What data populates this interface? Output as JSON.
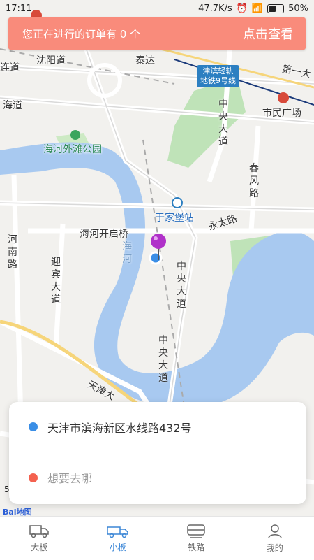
{
  "status": {
    "time": "17:11",
    "speed": "47.7K/s",
    "battery": "50%"
  },
  "banner": {
    "message": "您正在进行的订单有 0 个",
    "action": "点击查看"
  },
  "map": {
    "labels": {
      "shenyang_road": "沈阳道",
      "taida": "泰达",
      "lian_road": "连道",
      "hai_road": "海道",
      "haihe_park": "海河外滩公园",
      "yujiabu_station": "于家堡站",
      "haihe_kaiqi_bridge": "海河开启桥",
      "yongtai_road": "永太路",
      "first_ave": "第一大",
      "shimin_square": "市民广场",
      "zhongyang_1": "中央大道",
      "zhongyang_2": "中央大道",
      "zhongyang_3": "中央大道",
      "chunfeng_road": "春风路",
      "henan_road": "河南路",
      "yingbin_ave": "迎宾大道",
      "haihe_river": "海河",
      "tianjin_ave": "天津大"
    },
    "metro_badge": "津滨轻轨\n地铁9号线",
    "scale": "5",
    "logo_brand": "Bai",
    "logo_suffix": "地图"
  },
  "card": {
    "origin": "天津市滨海新区水线路432号",
    "destination_placeholder": "想要去哪",
    "origin_color": "#3a8ee6",
    "destination_color": "#f4614f"
  },
  "tabs": [
    {
      "label": "大板",
      "icon": "truck-icon",
      "active": false
    },
    {
      "label": "小板",
      "icon": "small-truck-icon",
      "active": true
    },
    {
      "label": "铁路",
      "icon": "train-icon",
      "active": false
    },
    {
      "label": "我的",
      "icon": "profile-icon",
      "active": false
    }
  ]
}
